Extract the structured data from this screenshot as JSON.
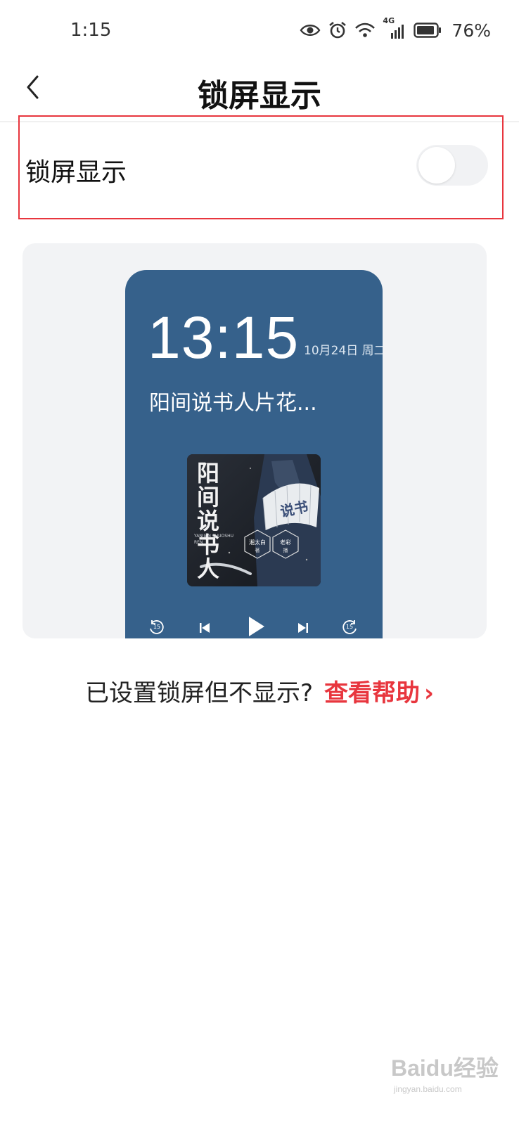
{
  "status_bar": {
    "time": "1:15",
    "network": "4G",
    "battery": "76%",
    "icons": [
      "eye-icon",
      "alarm-icon",
      "wifi-icon",
      "signal-icon",
      "battery-icon"
    ]
  },
  "header": {
    "title": "锁屏显示",
    "back_icon": "chevron-left-icon"
  },
  "setting": {
    "label": "锁屏显示",
    "enabled": false,
    "highlight_color": "#e8363e"
  },
  "preview": {
    "time": "13:15",
    "date": "10月24日 周二",
    "track_title": "阳间说书人片花...",
    "cover": {
      "title_art": "阳间说书人",
      "romanized": "YANJIAN SHUOSHU REN",
      "author": "湘太白",
      "author_role": "著",
      "narrator": "老彩",
      "narrator_role": "播",
      "fan_text": "说书"
    },
    "controls": [
      "rewind-15-icon",
      "previous-icon",
      "play-icon",
      "next-icon",
      "forward-15-icon"
    ],
    "skip_seconds": "15",
    "background_color": "#36618b"
  },
  "help": {
    "question": "已设置锁屏但不显示?",
    "link": "查看帮助",
    "chevron": "›",
    "link_color": "#e8363e"
  },
  "watermark": {
    "text": "Baidu经验",
    "sub": "jingyan.baidu.com"
  }
}
